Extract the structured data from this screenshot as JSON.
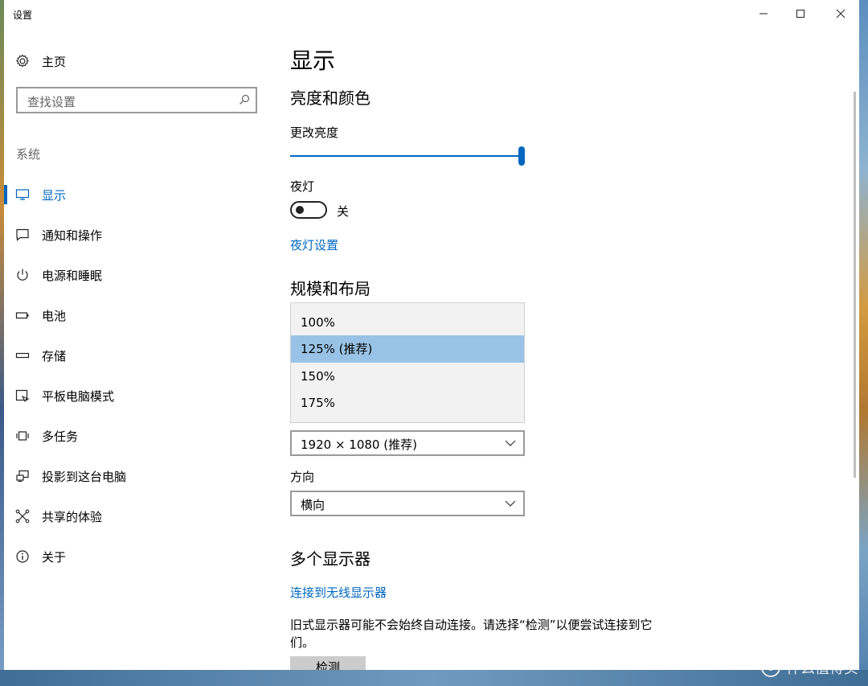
{
  "window": {
    "title": "设置",
    "controls": {
      "minimize": "—",
      "maximize": "☐",
      "close": "✕"
    }
  },
  "sidebar": {
    "home_label": "主页",
    "search_placeholder": "查找设置",
    "section_label": "系统",
    "items": [
      {
        "label": "显示",
        "icon": "monitor-icon",
        "active": true
      },
      {
        "label": "通知和操作",
        "icon": "notification-icon"
      },
      {
        "label": "电源和睡眠",
        "icon": "power-icon"
      },
      {
        "label": "电池",
        "icon": "battery-icon"
      },
      {
        "label": "存储",
        "icon": "storage-icon"
      },
      {
        "label": "平板电脑模式",
        "icon": "tablet-mode-icon"
      },
      {
        "label": "多任务",
        "icon": "multitask-icon"
      },
      {
        "label": "投影到这台电脑",
        "icon": "project-icon"
      },
      {
        "label": "共享的体验",
        "icon": "shared-experience-icon"
      },
      {
        "label": "关于",
        "icon": "info-icon"
      }
    ]
  },
  "main": {
    "page_title": "显示",
    "brightness": {
      "heading": "亮度和颜色",
      "label": "更改亮度",
      "value_fraction": 1.0
    },
    "night_light": {
      "label": "夜灯",
      "state": "关",
      "settings_link": "夜灯设置"
    },
    "scale_layout": {
      "heading": "规模和布局",
      "scale_options": [
        "100%",
        "125% (推荐)",
        "150%",
        "175%"
      ],
      "selected_index": 1,
      "resolution": "1920 × 1080 (推荐)",
      "orientation_label": "方向",
      "orientation": "横向"
    },
    "multiple_displays": {
      "heading": "多个显示器",
      "wireless_link": "连接到无线显示器",
      "note": "旧式显示器可能不会始终自动连接。请选择“检测”以便尝试连接到它们。",
      "detect_button": "检测"
    }
  },
  "watermark": "什么值得买",
  "colors": {
    "accent": "#0067c0",
    "selected_option": "#99c3e6"
  }
}
